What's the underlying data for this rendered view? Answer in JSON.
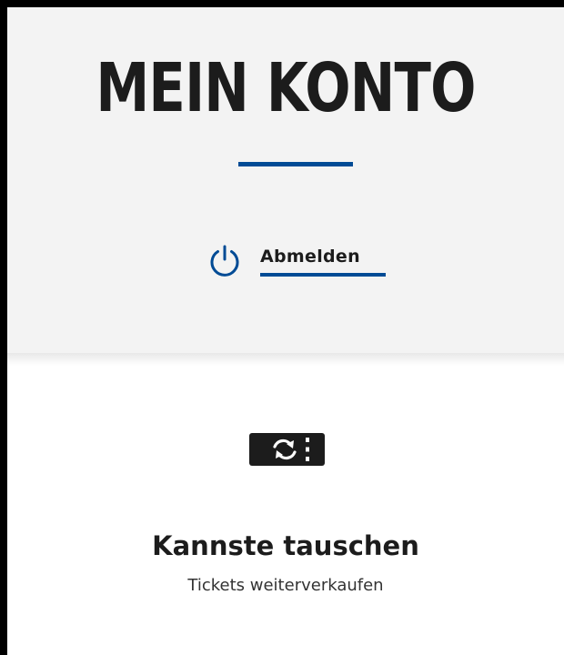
{
  "header": {
    "title": "MEIN KONTO",
    "accent_color": "#004b95",
    "background_color": "#f3f3f3"
  },
  "logout": {
    "label": "Abmelden",
    "icon": "power-icon"
  },
  "feature": {
    "icon": "ticket-exchange-icon",
    "title": "Kannste tauschen",
    "subtitle": "Tickets weiterverkaufen"
  }
}
